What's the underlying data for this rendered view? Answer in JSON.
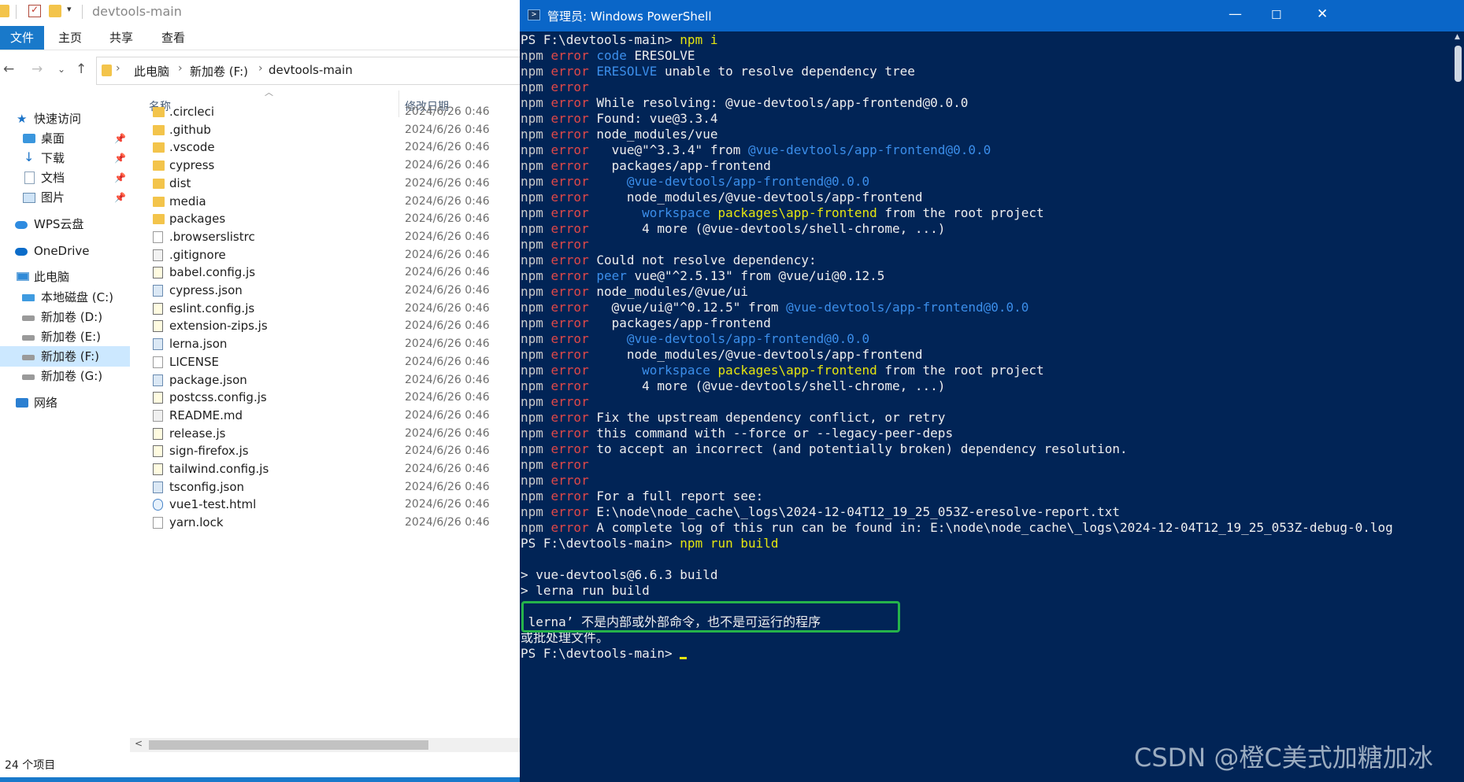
{
  "explorer": {
    "title": "devtools-main",
    "ribbon_tabs": [
      "文件",
      "主页",
      "共享",
      "查看"
    ],
    "breadcrumb": [
      "此电脑",
      "新加卷 (F:)",
      "devtools-main"
    ],
    "nav": {
      "quick_access": "快速访问",
      "desktop": "桌面",
      "downloads": "下载",
      "documents": "文档",
      "pictures": "图片",
      "wps": "WPS云盘",
      "onedrive": "OneDrive",
      "this_pc": "此电脑",
      "drive_c": "本地磁盘 (C:)",
      "drive_d": "新加卷 (D:)",
      "drive_e": "新加卷 (E:)",
      "drive_f": "新加卷 (F:)",
      "drive_g": "新加卷 (G:)",
      "network": "网络"
    },
    "columns": {
      "name": "名称",
      "modified": "修改日期"
    },
    "files": [
      {
        "name": ".circleci",
        "date": "2024/6/26 0:46",
        "type": "folder"
      },
      {
        "name": ".github",
        "date": "2024/6/26 0:46",
        "type": "folder"
      },
      {
        "name": ".vscode",
        "date": "2024/6/26 0:46",
        "type": "folder"
      },
      {
        "name": "cypress",
        "date": "2024/6/26 0:46",
        "type": "folder"
      },
      {
        "name": "dist",
        "date": "2024/6/26 0:46",
        "type": "folder"
      },
      {
        "name": "media",
        "date": "2024/6/26 0:46",
        "type": "folder"
      },
      {
        "name": "packages",
        "date": "2024/6/26 0:46",
        "type": "folder"
      },
      {
        "name": ".browserslistrc",
        "date": "2024/6/26 0:46",
        "type": "file"
      },
      {
        "name": ".gitignore",
        "date": "2024/6/26 0:46",
        "type": "git"
      },
      {
        "name": "babel.config.js",
        "date": "2024/6/26 0:46",
        "type": "js"
      },
      {
        "name": "cypress.json",
        "date": "2024/6/26 0:46",
        "type": "json"
      },
      {
        "name": "eslint.config.js",
        "date": "2024/6/26 0:46",
        "type": "js"
      },
      {
        "name": "extension-zips.js",
        "date": "2024/6/26 0:46",
        "type": "js"
      },
      {
        "name": "lerna.json",
        "date": "2024/6/26 0:46",
        "type": "json"
      },
      {
        "name": "LICENSE",
        "date": "2024/6/26 0:46",
        "type": "file"
      },
      {
        "name": "package.json",
        "date": "2024/6/26 0:46",
        "type": "json"
      },
      {
        "name": "postcss.config.js",
        "date": "2024/6/26 0:46",
        "type": "js"
      },
      {
        "name": "README.md",
        "date": "2024/6/26 0:46",
        "type": "md"
      },
      {
        "name": "release.js",
        "date": "2024/6/26 0:46",
        "type": "js"
      },
      {
        "name": "sign-firefox.js",
        "date": "2024/6/26 0:46",
        "type": "js"
      },
      {
        "name": "tailwind.config.js",
        "date": "2024/6/26 0:46",
        "type": "js"
      },
      {
        "name": "tsconfig.json",
        "date": "2024/6/26 0:46",
        "type": "json"
      },
      {
        "name": "vue1-test.html",
        "date": "2024/6/26 0:46",
        "type": "html"
      },
      {
        "name": "yarn.lock",
        "date": "2024/6/26 0:46",
        "type": "file"
      }
    ],
    "status": "24 个项目"
  },
  "powershell": {
    "title": "管理员: Windows PowerShell",
    "lines": [
      [
        {
          "t": "PS F:\\devtools-main> ",
          "c": "white"
        },
        {
          "t": "npm i",
          "c": "yel"
        }
      ],
      [
        {
          "t": "npm ",
          "c": "npm"
        },
        {
          "t": "error ",
          "c": "err"
        },
        {
          "t": "code ",
          "c": "code"
        },
        {
          "t": "ERESOLVE",
          "c": "white"
        }
      ],
      [
        {
          "t": "npm ",
          "c": "npm"
        },
        {
          "t": "error ",
          "c": "err"
        },
        {
          "t": "ERESOLVE ",
          "c": "code"
        },
        {
          "t": "unable to resolve dependency tree",
          "c": "white"
        }
      ],
      [
        {
          "t": "npm ",
          "c": "npm"
        },
        {
          "t": "error",
          "c": "err"
        }
      ],
      [
        {
          "t": "npm ",
          "c": "npm"
        },
        {
          "t": "error ",
          "c": "err"
        },
        {
          "t": "While resolving: @vue-devtools/app-frontend@0.0.0",
          "c": "white"
        }
      ],
      [
        {
          "t": "npm ",
          "c": "npm"
        },
        {
          "t": "error ",
          "c": "err"
        },
        {
          "t": "Found: vue@3.3.4",
          "c": "white"
        }
      ],
      [
        {
          "t": "npm ",
          "c": "npm"
        },
        {
          "t": "error ",
          "c": "err"
        },
        {
          "t": "node_modules/vue",
          "c": "white"
        }
      ],
      [
        {
          "t": "npm ",
          "c": "npm"
        },
        {
          "t": "error ",
          "c": "err"
        },
        {
          "t": "  vue@\"^3.3.4\" from ",
          "c": "white"
        },
        {
          "t": "@vue-devtools/app-frontend@0.0.0",
          "c": "blue"
        }
      ],
      [
        {
          "t": "npm ",
          "c": "npm"
        },
        {
          "t": "error ",
          "c": "err"
        },
        {
          "t": "  packages/app-frontend",
          "c": "white"
        }
      ],
      [
        {
          "t": "npm ",
          "c": "npm"
        },
        {
          "t": "error ",
          "c": "err"
        },
        {
          "t": "    @vue-devtools/app-frontend@0.0.0",
          "c": "blue"
        }
      ],
      [
        {
          "t": "npm ",
          "c": "npm"
        },
        {
          "t": "error ",
          "c": "err"
        },
        {
          "t": "    node_modules/@vue-devtools/app-frontend",
          "c": "white"
        }
      ],
      [
        {
          "t": "npm ",
          "c": "npm"
        },
        {
          "t": "error ",
          "c": "err"
        },
        {
          "t": "      workspace ",
          "c": "blue"
        },
        {
          "t": "packages\\app-frontend",
          "c": "yel"
        },
        {
          "t": " from the root project",
          "c": "white"
        }
      ],
      [
        {
          "t": "npm ",
          "c": "npm"
        },
        {
          "t": "error ",
          "c": "err"
        },
        {
          "t": "      4 more (@vue-devtools/shell-chrome, ...)",
          "c": "white"
        }
      ],
      [
        {
          "t": "npm ",
          "c": "npm"
        },
        {
          "t": "error",
          "c": "err"
        }
      ],
      [
        {
          "t": "npm ",
          "c": "npm"
        },
        {
          "t": "error ",
          "c": "err"
        },
        {
          "t": "Could not resolve dependency:",
          "c": "white"
        }
      ],
      [
        {
          "t": "npm ",
          "c": "npm"
        },
        {
          "t": "error ",
          "c": "err"
        },
        {
          "t": "peer ",
          "c": "code"
        },
        {
          "t": "vue@\"^2.5.13\" from @vue/ui@0.12.5",
          "c": "white"
        }
      ],
      [
        {
          "t": "npm ",
          "c": "npm"
        },
        {
          "t": "error ",
          "c": "err"
        },
        {
          "t": "node_modules/@vue/ui",
          "c": "white"
        }
      ],
      [
        {
          "t": "npm ",
          "c": "npm"
        },
        {
          "t": "error ",
          "c": "err"
        },
        {
          "t": "  @vue/ui@\"^0.12.5\" from ",
          "c": "white"
        },
        {
          "t": "@vue-devtools/app-frontend@0.0.0",
          "c": "blue"
        }
      ],
      [
        {
          "t": "npm ",
          "c": "npm"
        },
        {
          "t": "error ",
          "c": "err"
        },
        {
          "t": "  packages/app-frontend",
          "c": "white"
        }
      ],
      [
        {
          "t": "npm ",
          "c": "npm"
        },
        {
          "t": "error ",
          "c": "err"
        },
        {
          "t": "    @vue-devtools/app-frontend@0.0.0",
          "c": "blue"
        }
      ],
      [
        {
          "t": "npm ",
          "c": "npm"
        },
        {
          "t": "error ",
          "c": "err"
        },
        {
          "t": "    node_modules/@vue-devtools/app-frontend",
          "c": "white"
        }
      ],
      [
        {
          "t": "npm ",
          "c": "npm"
        },
        {
          "t": "error ",
          "c": "err"
        },
        {
          "t": "      workspace ",
          "c": "blue"
        },
        {
          "t": "packages\\app-frontend",
          "c": "yel"
        },
        {
          "t": " from the root project",
          "c": "white"
        }
      ],
      [
        {
          "t": "npm ",
          "c": "npm"
        },
        {
          "t": "error ",
          "c": "err"
        },
        {
          "t": "      4 more (@vue-devtools/shell-chrome, ...)",
          "c": "white"
        }
      ],
      [
        {
          "t": "npm ",
          "c": "npm"
        },
        {
          "t": "error",
          "c": "err"
        }
      ],
      [
        {
          "t": "npm ",
          "c": "npm"
        },
        {
          "t": "error ",
          "c": "err"
        },
        {
          "t": "Fix the upstream dependency conflict, or retry",
          "c": "white"
        }
      ],
      [
        {
          "t": "npm ",
          "c": "npm"
        },
        {
          "t": "error ",
          "c": "err"
        },
        {
          "t": "this command with --force or --legacy-peer-deps",
          "c": "white"
        }
      ],
      [
        {
          "t": "npm ",
          "c": "npm"
        },
        {
          "t": "error ",
          "c": "err"
        },
        {
          "t": "to accept an incorrect (and potentially broken) dependency resolution.",
          "c": "white"
        }
      ],
      [
        {
          "t": "npm ",
          "c": "npm"
        },
        {
          "t": "error",
          "c": "err"
        }
      ],
      [
        {
          "t": "npm ",
          "c": "npm"
        },
        {
          "t": "error",
          "c": "err"
        }
      ],
      [
        {
          "t": "npm ",
          "c": "npm"
        },
        {
          "t": "error ",
          "c": "err"
        },
        {
          "t": "For a full report see:",
          "c": "white"
        }
      ],
      [
        {
          "t": "npm ",
          "c": "npm"
        },
        {
          "t": "error ",
          "c": "err"
        },
        {
          "t": "E:\\node\\node_cache\\_logs\\2024-12-04T12_19_25_053Z-eresolve-report.txt",
          "c": "white"
        }
      ],
      [
        {
          "t": "npm ",
          "c": "npm"
        },
        {
          "t": "error ",
          "c": "err"
        },
        {
          "t": "A complete log of this run can be found in: E:\\node\\node_cache\\_logs\\2024-12-04T12_19_25_053Z-debug-0.log",
          "c": "white"
        }
      ],
      [
        {
          "t": "PS F:\\devtools-main> ",
          "c": "white"
        },
        {
          "t": "npm run build",
          "c": "yel"
        }
      ],
      [],
      [
        {
          "t": "> vue-devtools@6.6.3 build",
          "c": "white"
        }
      ],
      [
        {
          "t": "> lerna run build",
          "c": "white"
        }
      ],
      [],
      [
        {
          "t": " lerna’ 不是内部或外部命令，也不是可运行的程序",
          "c": "white"
        }
      ],
      [
        {
          "t": "或批处理文件。",
          "c": "white"
        }
      ],
      [
        {
          "t": "PS F:\\devtools-main> ",
          "c": "white"
        },
        {
          "t": "",
          "c": "cursor"
        }
      ]
    ]
  },
  "watermark": "CSDN @橙C美式加糖加冰"
}
